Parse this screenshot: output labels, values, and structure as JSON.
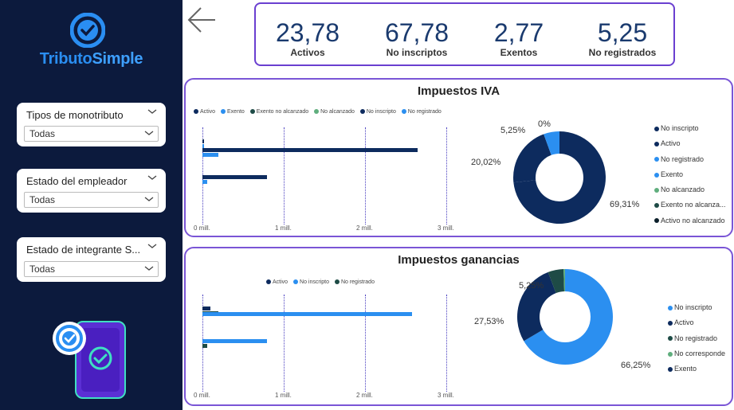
{
  "brand": {
    "name_a": "Tributo",
    "name_b": "Simple"
  },
  "filters": [
    {
      "title": "Tipos de monotributo",
      "value": "Todas"
    },
    {
      "title": "Estado del empleador",
      "value": "Todas"
    },
    {
      "title": "Estado de integrante S...",
      "value": "Todas"
    }
  ],
  "kpis": [
    {
      "value": "23,78",
      "label": "Activos"
    },
    {
      "value": "67,78",
      "label": "No inscriptos"
    },
    {
      "value": "2,77",
      "label": "Exentos"
    },
    {
      "value": "5,25",
      "label": "No registrados"
    }
  ],
  "colors": {
    "navy": "#0d2b5e",
    "blue": "#2b8ff0",
    "teal": "#1e4b46",
    "green": "#5fae7d",
    "purple": "#7a55d6"
  },
  "iva": {
    "title": "Impuestos IVA",
    "legend": [
      "Activo",
      "Exento",
      "Exento no alcanzado",
      "No alcanzado",
      "No inscripto",
      "No registrado"
    ],
    "axis_ticks": [
      "0 mill.",
      "1 mill.",
      "2 mill.",
      "3 mill."
    ],
    "donut_labels": {
      "a": "5,25%",
      "b": "0%",
      "c": "20,02%",
      "d": "69,31%"
    },
    "legend_right": [
      "No inscripto",
      "Activo",
      "No registrado",
      "Exento",
      "No alcanzado",
      "Exento no alcanza...",
      "Activo no alcanzado"
    ]
  },
  "ganancias": {
    "title": "Impuestos ganancias",
    "legend": [
      "Activo",
      "No inscripto",
      "No registrado"
    ],
    "axis_ticks": [
      "0 mill.",
      "1 mill.",
      "2 mill.",
      "3 mill."
    ],
    "donut_labels": {
      "a": "5,25%",
      "c": "27,53%",
      "d": "66,25%"
    },
    "legend_right": [
      "No inscripto",
      "Activo",
      "No registrado",
      "No corresponde",
      "Exento"
    ]
  },
  "chart_data": [
    {
      "type": "bar",
      "title": "Impuestos IVA",
      "xlim": [
        0,
        3000000
      ],
      "series_order": [
        "Activo",
        "Exento",
        "No inscripto",
        "No registrado"
      ],
      "groups": [
        {
          "values": {
            "Activo": 20000,
            "Exento": 0
          }
        },
        {
          "values": {
            "No inscripto": 2650000,
            "No registrado": 200000
          }
        },
        {
          "values": {
            "No inscripto": 790000,
            "No registrado": 60000
          }
        }
      ]
    },
    {
      "type": "pie",
      "title": "Impuestos IVA",
      "slices": [
        {
          "label": "No inscripto",
          "value": 69.31
        },
        {
          "label": "Activo",
          "value": 20.02
        },
        {
          "label": "No registrado",
          "value": 5.25
        },
        {
          "label": "Exento",
          "value": 0
        }
      ]
    },
    {
      "type": "bar",
      "title": "Impuestos ganancias",
      "xlim": [
        0,
        3000000
      ],
      "groups": [
        {
          "values": {
            "Activo": 100000,
            "No registrado": 200000
          }
        },
        {
          "values": {
            "No inscripto": 2580000
          }
        },
        {
          "values": {
            "No inscripto": 790000,
            "No registrado": 60000
          }
        }
      ]
    },
    {
      "type": "pie",
      "title": "Impuestos ganancias",
      "slices": [
        {
          "label": "No inscripto",
          "value": 66.25
        },
        {
          "label": "Activo",
          "value": 27.53
        },
        {
          "label": "No registrado",
          "value": 5.25
        },
        {
          "label": "No corresponde",
          "value": 0.5
        }
      ]
    }
  ]
}
